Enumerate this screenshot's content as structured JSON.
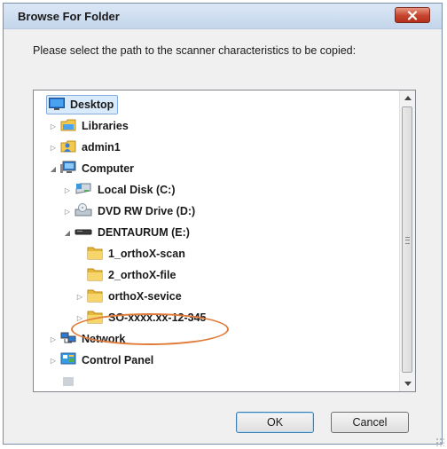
{
  "window": {
    "title": "Browse For Folder",
    "close_icon": "close-icon"
  },
  "instruction": "Please select the path to the scanner characteristics to be copied:",
  "tree": {
    "items": [
      {
        "label": "Desktop",
        "icon": "desktop-icon",
        "expander": "",
        "selected": true
      },
      {
        "label": "Libraries",
        "icon": "libraries-icon",
        "expander": "collapsed"
      },
      {
        "label": "admin1",
        "icon": "user-folder-icon",
        "expander": "collapsed"
      },
      {
        "label": "Computer",
        "icon": "computer-icon",
        "expander": "expanded"
      },
      {
        "label": "Local Disk (C:)",
        "icon": "local-disk-icon",
        "expander": "collapsed"
      },
      {
        "label": "DVD RW Drive (D:)",
        "icon": "dvd-drive-icon",
        "expander": "collapsed"
      },
      {
        "label": "DENTAURUM (E:)",
        "icon": "usb-drive-icon",
        "expander": "expanded"
      },
      {
        "label": "1_orthoX-scan",
        "icon": "folder-icon",
        "expander": ""
      },
      {
        "label": "2_orthoX-file",
        "icon": "folder-icon",
        "expander": ""
      },
      {
        "label": "orthoX-sevice",
        "icon": "folder-icon",
        "expander": "collapsed"
      },
      {
        "label": "SO-xxxx.xx-12-345",
        "icon": "folder-icon",
        "expander": "collapsed",
        "highlighted": true
      },
      {
        "label": "Network",
        "icon": "network-icon",
        "expander": "collapsed"
      },
      {
        "label": "Control Panel",
        "icon": "control-panel-icon",
        "expander": "collapsed"
      }
    ]
  },
  "buttons": {
    "ok_label": "OK",
    "cancel_label": "Cancel"
  },
  "colors": {
    "highlight_ellipse": "#e07b3a",
    "selection_bg": "#d9ebfb",
    "close_button": "#c6432d"
  }
}
